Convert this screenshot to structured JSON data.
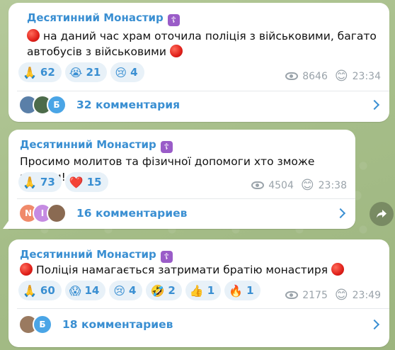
{
  "messages": [
    {
      "sender": "Десятинний Монастир",
      "text": "на даний час храм оточила поліція з військовими, багато автобусів з військовими",
      "reactions": [
        {
          "emoji": "🙏",
          "count": "62"
        },
        {
          "emoji": "😭",
          "count": "21"
        },
        {
          "emoji": "😢",
          "count": "4"
        }
      ],
      "views": "8646",
      "time": "23:34",
      "comments": "32 комментария",
      "avatars": [
        {
          "letter": "",
          "color": "#5a7fa8"
        },
        {
          "letter": "",
          "color": "#4c6b4a"
        },
        {
          "letter": "Б",
          "color": "#4aa5e6"
        }
      ]
    },
    {
      "sender": "Десятинний Монастир",
      "text": "Просимо молитов та фізичної допомоги хто зможе підійти!",
      "reactions": [
        {
          "emoji": "🙏",
          "count": "73"
        },
        {
          "emoji": "❤️",
          "count": "15"
        }
      ],
      "views": "4504",
      "time": "23:38",
      "comments": "16 комментариев",
      "avatars": [
        {
          "letter": "N",
          "color": "#f08a6a"
        },
        {
          "letter": "I",
          "color": "#c58be2"
        },
        {
          "letter": "",
          "color": "#8a6a52"
        }
      ]
    },
    {
      "sender": "Десятинний Монастир",
      "text": "Поліція намагається затримати братію монастиря",
      "reactions": [
        {
          "emoji": "🙏",
          "count": "60"
        },
        {
          "emoji": "😱",
          "count": "14"
        },
        {
          "emoji": "😢",
          "count": "4"
        },
        {
          "emoji": "🤣",
          "count": "2"
        },
        {
          "emoji": "👍",
          "count": "1"
        },
        {
          "emoji": "🔥",
          "count": "1"
        }
      ],
      "views": "2175",
      "time": "23:49",
      "comments": "18 комментариев",
      "avatars": [
        {
          "letter": "",
          "color": "#9a7a60"
        },
        {
          "letter": "Б",
          "color": "#4aa5e6"
        }
      ]
    }
  ],
  "icons": {
    "channel_badge": "orthodox-cross-icon",
    "views": "eye-icon",
    "share": "share-arrow-icon",
    "chevron": "chevron-right-icon"
  }
}
